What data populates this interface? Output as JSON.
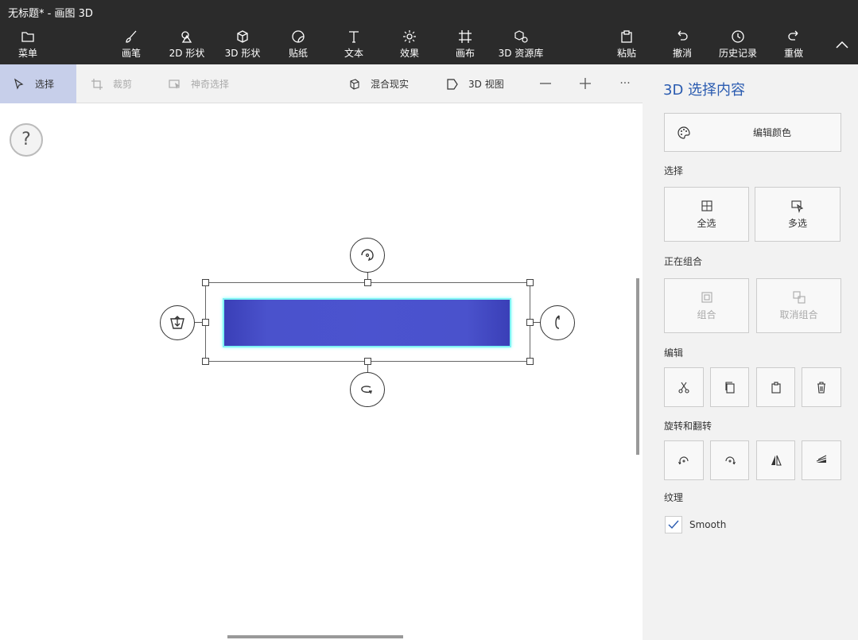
{
  "window": {
    "title": "无标题* - 画图 3D"
  },
  "ribbon": {
    "menu": "菜单",
    "brushes": "画笔",
    "shapes2d": "2D 形状",
    "shapes3d": "3D 形状",
    "stickers": "贴纸",
    "text": "文本",
    "effects": "效果",
    "canvas": "画布",
    "library3d": "3D 资源库",
    "paste": "粘贴",
    "undo": "撤消",
    "history": "历史记录",
    "redo": "重做"
  },
  "subtoolbar": {
    "select": "选择",
    "crop": "裁剪",
    "magic_select": "神奇选择",
    "mixed_reality": "混合现实",
    "view3d": "3D 视图",
    "more": "···"
  },
  "canvas": {
    "help": "?"
  },
  "panel": {
    "title": "3D 选择内容",
    "edit_color": "编辑颜色",
    "section_select": "选择",
    "select_all": "全选",
    "multi_select": "多选",
    "section_group": "正在组合",
    "group": "组合",
    "ungroup": "取消组合",
    "section_edit": "编辑",
    "section_rotate": "旋转和翻转",
    "section_texture": "纹理",
    "smooth": "Smooth"
  },
  "colors": {
    "accent": "#2a5bb0",
    "object": "#4b53cf",
    "object_outline": "#7ff2f4",
    "topbar": "#2b2b2b"
  }
}
